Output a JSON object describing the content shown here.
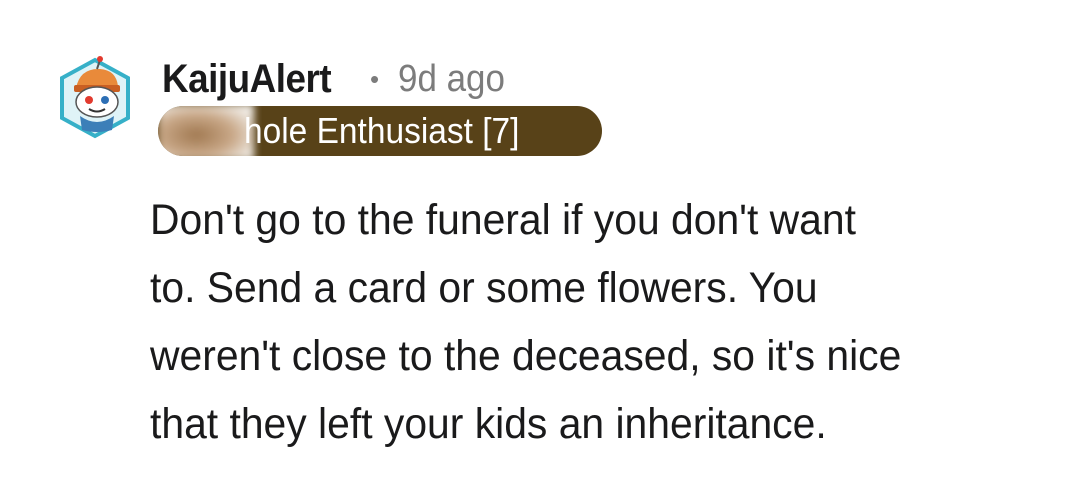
{
  "comment": {
    "author": "KaijuAlert",
    "separator": "•",
    "time_ago": "9d ago",
    "flair": "hole Enthusiast [7]",
    "body": "Don't go to the funeral if you don't want\nto. Send a card or some flowers. You\nweren't close to the deceased, so it's nice\nthat they left your kids an inheritance.",
    "avatar_icon": "snoo-avatar-icon"
  },
  "colors": {
    "flair_bg": "#584218",
    "avatar_border": "#36b0c8",
    "meta_gray": "#7c7c7c",
    "text": "#1a1a1b"
  }
}
